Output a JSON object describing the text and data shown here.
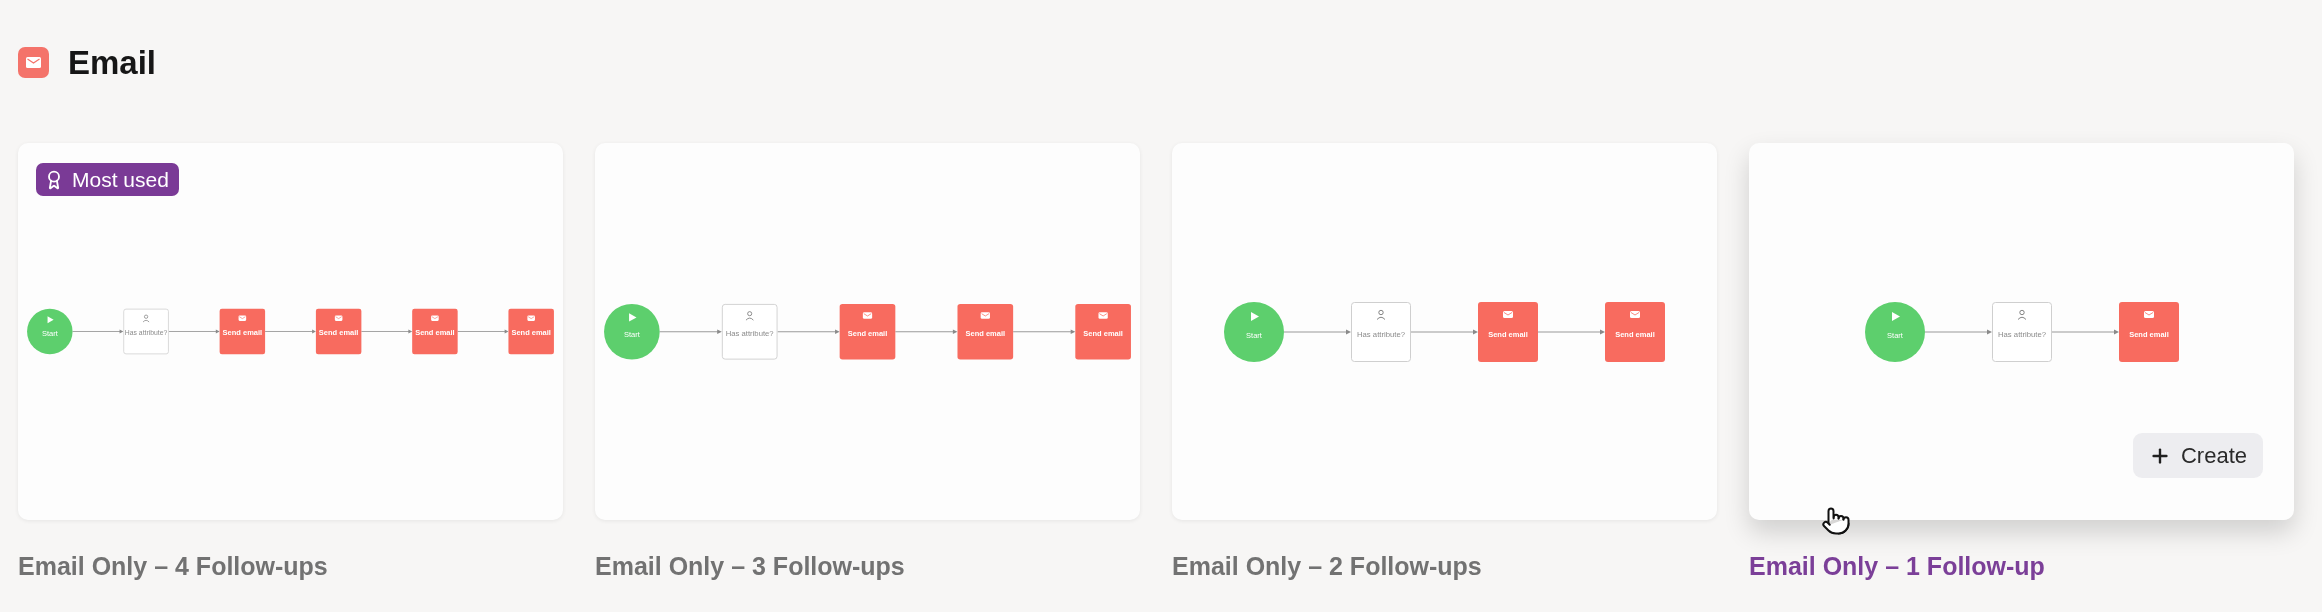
{
  "section": {
    "title": "Email"
  },
  "templates": [
    {
      "title": "Email Only – 4 Follow-ups",
      "badge": "Most used",
      "hovered": false,
      "nodes": [
        {
          "kind": "start",
          "label": "Start"
        },
        {
          "kind": "condition",
          "label": "Has attribute?"
        },
        {
          "kind": "email",
          "label": "Send email"
        },
        {
          "kind": "email",
          "label": "Send email"
        },
        {
          "kind": "email",
          "label": "Send email"
        },
        {
          "kind": "email",
          "label": "Send email"
        }
      ]
    },
    {
      "title": "Email Only – 3 Follow-ups",
      "hovered": false,
      "nodes": [
        {
          "kind": "start",
          "label": "Start"
        },
        {
          "kind": "condition",
          "label": "Has attribute?"
        },
        {
          "kind": "email",
          "label": "Send email"
        },
        {
          "kind": "email",
          "label": "Send email"
        },
        {
          "kind": "email",
          "label": "Send email"
        }
      ]
    },
    {
      "title": "Email Only – 2 Follow-ups",
      "hovered": false,
      "nodes": [
        {
          "kind": "start",
          "label": "Start"
        },
        {
          "kind": "condition",
          "label": "Has attribute?"
        },
        {
          "kind": "email",
          "label": "Send email"
        },
        {
          "kind": "email",
          "label": "Send email"
        }
      ]
    },
    {
      "title": "Email Only – 1 Follow-up",
      "hovered": true,
      "action": "Create",
      "nodes": [
        {
          "kind": "start",
          "label": "Start"
        },
        {
          "kind": "condition",
          "label": "Has attribute?"
        },
        {
          "kind": "email",
          "label": "Send email"
        }
      ]
    }
  ]
}
